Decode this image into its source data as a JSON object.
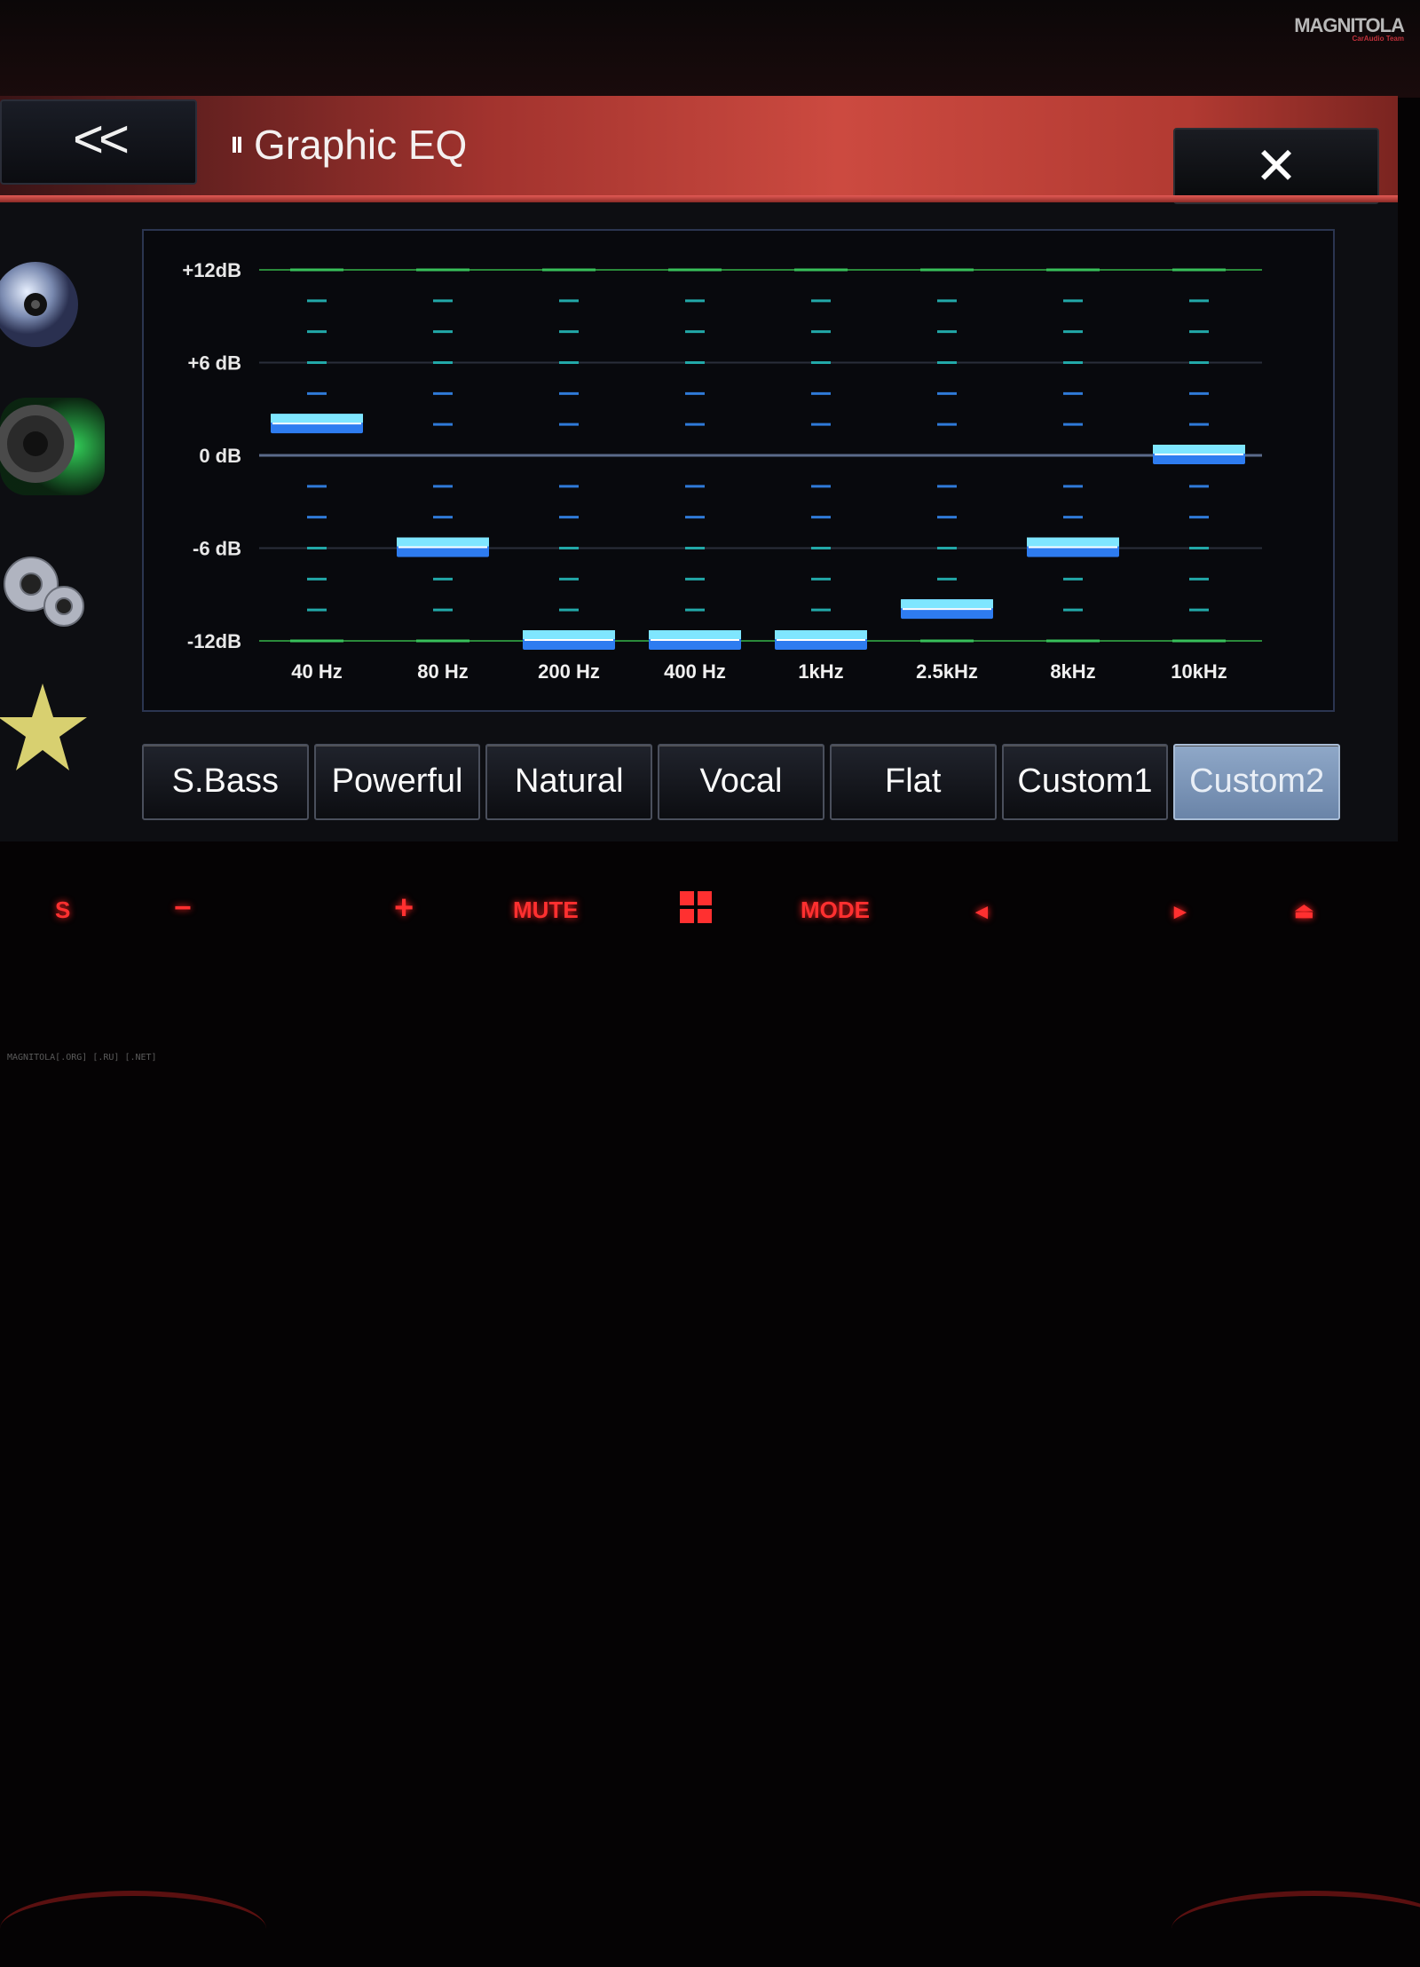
{
  "brand": {
    "logo_text": "MAGNITOLA",
    "logo_sub": "CarAudio Team"
  },
  "header": {
    "back_label": "<<",
    "title": "Graphic EQ",
    "close_label": "✕"
  },
  "sidebar": {
    "items": [
      {
        "icon": "disc-icon"
      },
      {
        "icon": "speaker-icon"
      },
      {
        "icon": "gears-icon"
      },
      {
        "icon": "star-icon"
      }
    ]
  },
  "eq": {
    "y_labels": [
      "+12dB",
      "+6 dB",
      "0 dB",
      "-6 dB",
      "-12dB"
    ],
    "bands": [
      "40 Hz",
      "80 Hz",
      "200 Hz",
      "400 Hz",
      "1kHz",
      "2.5kHz",
      "8kHz",
      "10kHz"
    ],
    "levels_db": [
      2,
      -6,
      -12,
      -12,
      -12,
      -10,
      -6,
      0
    ],
    "range_db": [
      -12,
      12
    ]
  },
  "presets": {
    "items": [
      "S.Bass",
      "Powerful",
      "Natural",
      "Vocal",
      "Flat",
      "Custom1",
      "Custom2"
    ],
    "selected": "Custom2"
  },
  "hardware": {
    "s_label": "S",
    "minus_label": "−",
    "plus_label": "+",
    "mute_label": "MUTE",
    "mode_label": "MODE",
    "prev_label": "◄",
    "next_label": "►",
    "eject_label": "⏏"
  },
  "credit": "MAGNITOLA[.ORG] [.RU] [.NET]",
  "colors": {
    "accent_red": "#cc4a40",
    "slider_blue": "#3aa8ff",
    "grid_green": "#2fae4a",
    "selected_preset": "#7f99bd"
  }
}
